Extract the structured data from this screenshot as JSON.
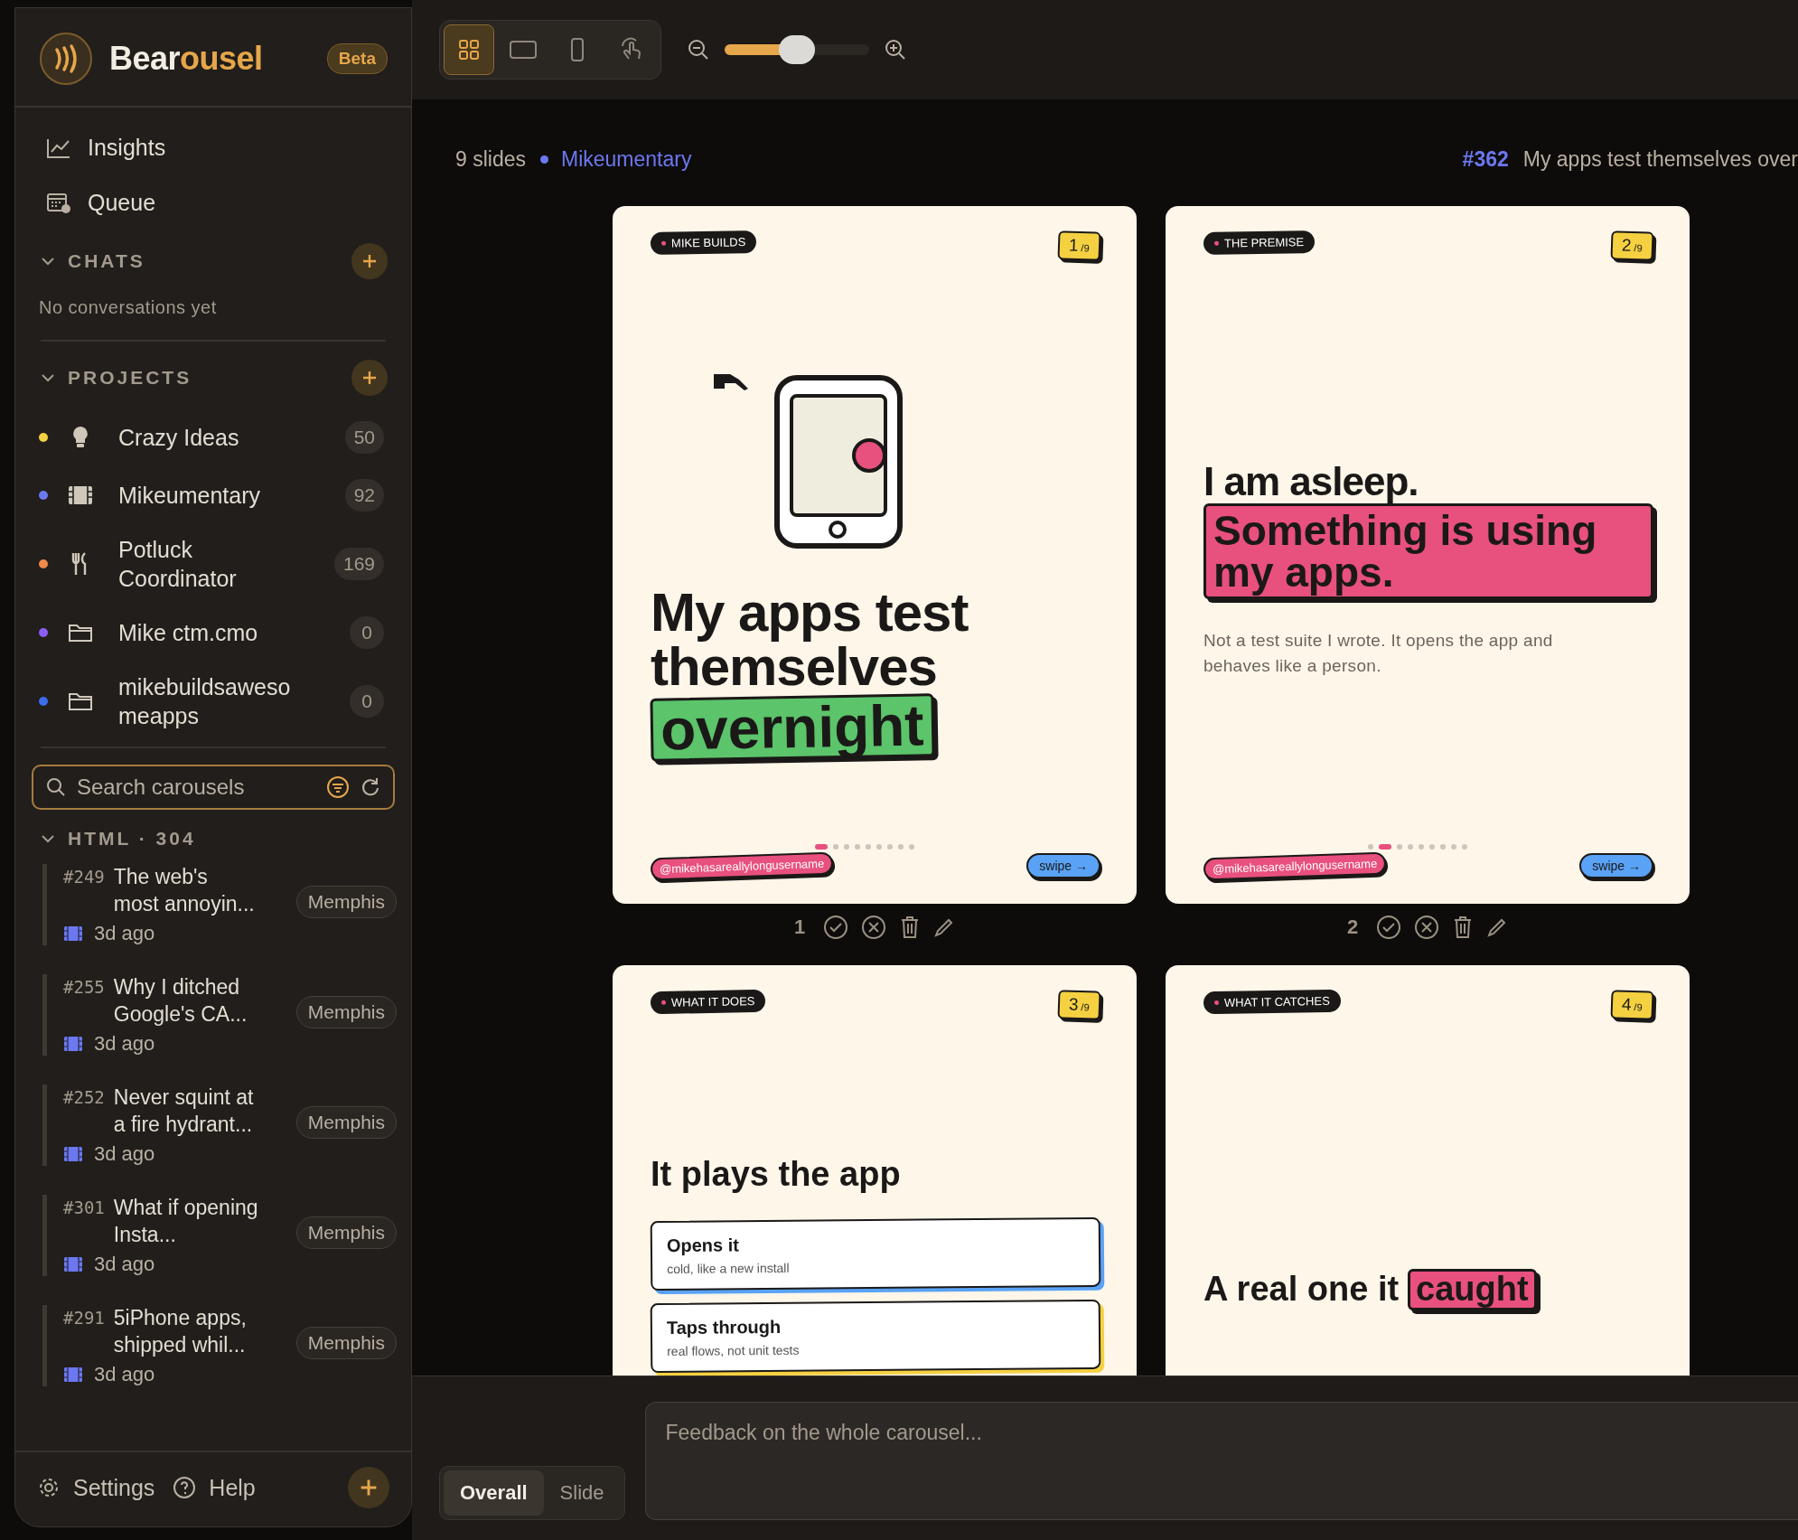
{
  "brand": {
    "name_start": "Bear",
    "name_end": "ousel",
    "badge": "Beta"
  },
  "view_modes": [
    {
      "kind": "grid",
      "selected": true
    },
    {
      "kind": "single",
      "selected": false
    },
    {
      "kind": "phone",
      "selected": false
    },
    {
      "kind": "touch",
      "selected": false
    }
  ],
  "zoom": {
    "level": 0.5
  },
  "nav": [
    {
      "kind": "insights",
      "label": "Insights"
    },
    {
      "kind": "queue",
      "label": "Queue"
    }
  ],
  "chats": {
    "title": "CHATS",
    "expanded": true,
    "empty_text": "No conversations yet"
  },
  "projects": {
    "title": "PROJECTS",
    "expanded": true,
    "items": [
      {
        "name": "Crazy Ideas",
        "count": "50",
        "color": "#f5d142",
        "kind": "bulb"
      },
      {
        "name": "Mikeumentary",
        "count": "92",
        "color": "#6b78f0",
        "kind": "film"
      },
      {
        "name": "Potluck Coordinator",
        "count": "169",
        "color": "#f08a4b",
        "kind": "fork"
      },
      {
        "name": "Mike ctm.cmo",
        "count": "0",
        "color": "#8b5cf6",
        "kind": "folder"
      },
      {
        "name": "mikebuildsawesomeapps",
        "count": "0",
        "color": "#3b6cf0",
        "kind": "folder"
      }
    ]
  },
  "search": {
    "placeholder": "Search carousels"
  },
  "carousels": {
    "title": "HTML · 304",
    "expanded": true,
    "items": [
      {
        "id": "#249",
        "title": "The web's most annoyin...",
        "tag": "Memphis",
        "time": "3d ago"
      },
      {
        "id": "#255",
        "title": "Why I ditched Google's CA...",
        "tag": "Memphis",
        "time": "3d ago"
      },
      {
        "id": "#252",
        "title": "Never squint at a fire hydrant...",
        "tag": "Memphis",
        "time": "3d ago"
      },
      {
        "id": "#301",
        "title": "What if opening Insta...",
        "tag": "Memphis",
        "time": "3d ago"
      },
      {
        "id": "#291",
        "title": "5iPhone apps, shipped whil...",
        "tag": "Memphis",
        "time": "3d ago"
      }
    ]
  },
  "footer": {
    "settings": "Settings",
    "help": "Help"
  },
  "header": {
    "count": "9 slides",
    "project": "Mikeumentary",
    "carousel_id": "#362",
    "carousel_title": "My apps test themselves over"
  },
  "slides": [
    {
      "kind": "illustrated",
      "tag": "MIKE BUILDS",
      "number": "1",
      "total": "/9",
      "headline": "My apps test themselves",
      "highlight": {
        "text": "overnight",
        "color": "#5cc46a"
      },
      "handle": "@mikehasareallylongusername",
      "swipe": "swipe →",
      "dots": [
        {
          "selected": true
        },
        {
          "selected": false
        },
        {
          "selected": false
        },
        {
          "selected": false
        },
        {
          "selected": false
        },
        {
          "selected": false
        },
        {
          "selected": false
        },
        {
          "selected": false
        },
        {
          "selected": false
        }
      ],
      "action_number": "1"
    },
    {
      "kind": "statement",
      "tag": "THE PREMISE",
      "number": "2",
      "total": "/9",
      "headline": "I am asleep.",
      "highlight": {
        "text": "Something is using my apps.",
        "color": "#e8507e"
      },
      "body": "Not a test suite I wrote. It opens the app and behaves like a person.",
      "handle": "@mikehasareallylongusername",
      "swipe": "swipe →",
      "dots": [
        {
          "selected": false
        },
        {
          "selected": true
        },
        {
          "selected": false
        },
        {
          "selected": false
        },
        {
          "selected": false
        },
        {
          "selected": false
        },
        {
          "selected": false
        },
        {
          "selected": false
        },
        {
          "selected": false
        }
      ],
      "action_number": "2"
    },
    {
      "kind": "steps",
      "tag": "WHAT IT DOES",
      "number": "3",
      "total": "/9",
      "headline": "It plays the app",
      "steps": [
        {
          "title": "Opens it",
          "note": "cold, like a new install",
          "color": "#5aa2f5"
        },
        {
          "title": "Taps through",
          "note": "real flows, not unit tests",
          "color": "#f5d142"
        }
      ]
    },
    {
      "kind": "inline",
      "tag": "WHAT IT CATCHES",
      "number": "4",
      "total": "/9",
      "headline": "A real one it",
      "highlight": {
        "text": "caught",
        "color": "#e8507e"
      }
    }
  ],
  "feedback": {
    "modes": [
      {
        "label": "Overall",
        "selected": true
      },
      {
        "label": "Slide",
        "selected": false
      }
    ],
    "placeholder": "Feedback on the whole carousel..."
  }
}
